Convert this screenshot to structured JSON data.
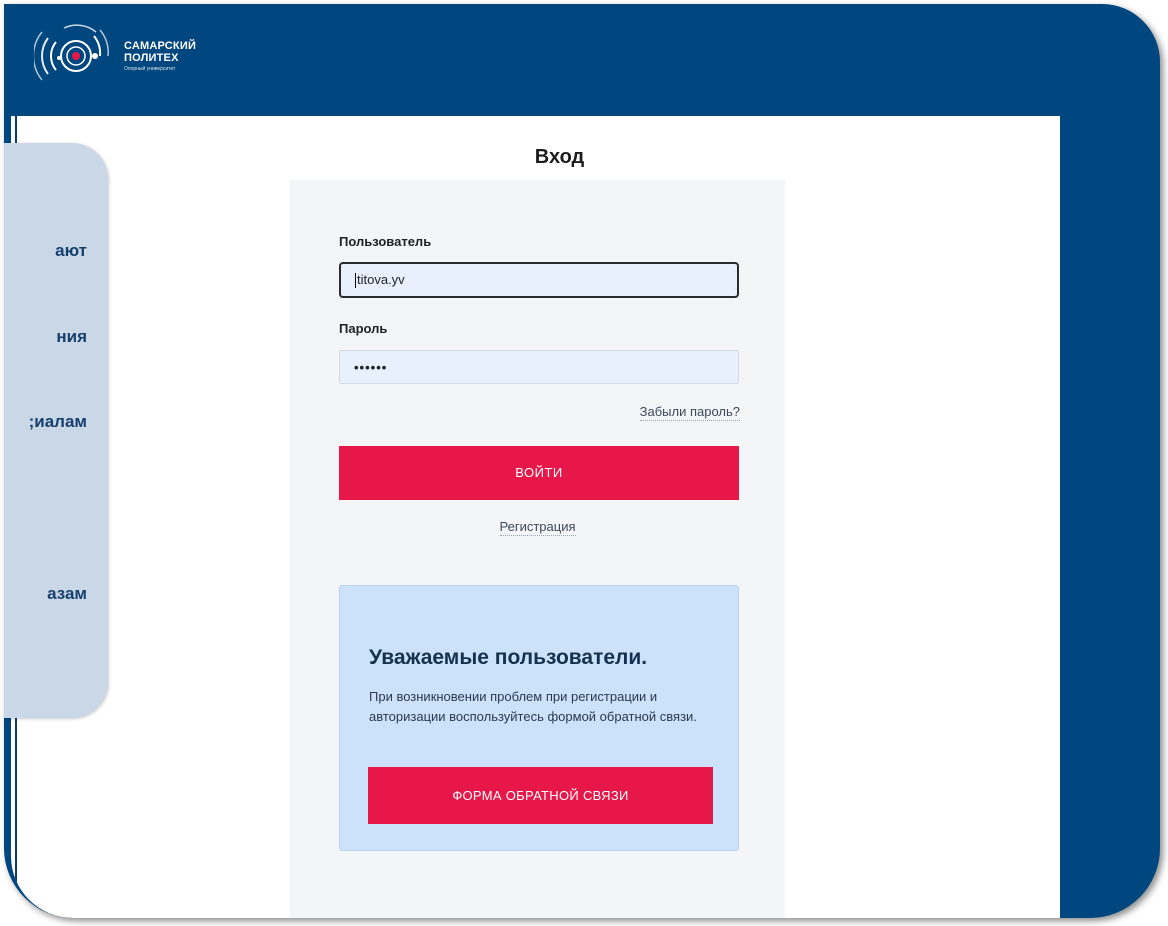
{
  "brand": {
    "line1": "САМАРСКИЙ",
    "line2": "ПОЛИТЕХ",
    "line3": "Опорный университет"
  },
  "side_panel": {
    "lines": [
      "ают",
      "ния",
      "иалам;",
      "азам"
    ]
  },
  "login": {
    "title": "Вход",
    "username_label": "Пользователь",
    "username_value": "titova.yv",
    "password_label": "Пароль",
    "password_value": "••••••",
    "forgot_link": "Забыли пароль?",
    "submit_button": "ВОЙТИ",
    "register_link": "Регистрация"
  },
  "notice": {
    "title": "Уважаемые пользователи.",
    "text": "При возникновении проблем при регистрации и авторизации воспользуйтесь формой обратной связи.",
    "button": "ФОРМА ОБРАТНОЙ СВЯЗИ"
  },
  "colors": {
    "frame": "#00467f",
    "accent": "#e8174a",
    "notice_bg": "#cce2fb",
    "side_card": "#cad7e6"
  },
  "icons": {
    "logo": "polytech-logo-icon"
  }
}
